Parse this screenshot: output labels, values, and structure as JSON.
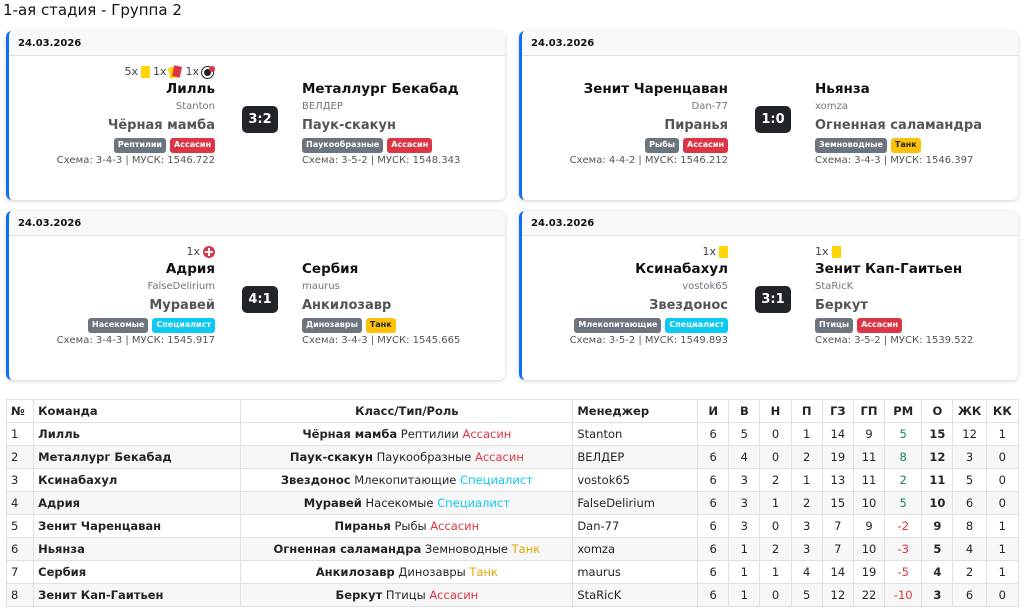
{
  "page": {
    "title": "1-ая стадия - Группа 2"
  },
  "colors": {
    "accent": "#0d6efd",
    "badge_gray": "#6c757d",
    "badge_red": "#dc3545",
    "badge_cyan": "#0dcaf0",
    "badge_yellow": "#ffc107"
  },
  "matches": [
    {
      "date": "24.03.2026",
      "score": "3:2",
      "home": {
        "events": [
          {
            "count": "5x",
            "icon": "yellow-card-icon"
          },
          {
            "count": "1x",
            "icon": "red-card-icon"
          },
          {
            "count": "1x",
            "icon": "own-goal-icon"
          }
        ],
        "team": "Лилль",
        "manager": "Stanton",
        "character": "Чёрная мамба",
        "badges": [
          {
            "text": "Рептилии",
            "color": "#6c757d"
          },
          {
            "text": "Ассасин",
            "color": "#dc3545"
          }
        ],
        "scheme": "Схема: 3-4-3 | МУСК: 1546.722"
      },
      "away": {
        "events": [],
        "team": "Металлург Бекабад",
        "manager": "ВЕЛДЕР",
        "character": "Паук-скакун",
        "badges": [
          {
            "text": "Паукообразные",
            "color": "#6c757d"
          },
          {
            "text": "Ассасин",
            "color": "#dc3545"
          }
        ],
        "scheme": "Схема: 3-5-2 | МУСК: 1548.343"
      }
    },
    {
      "date": "24.03.2026",
      "score": "1:0",
      "home": {
        "events": [],
        "team": "Зенит Чаренцаван",
        "manager": "Dan-77",
        "character": "Пиранья",
        "badges": [
          {
            "text": "Рыбы",
            "color": "#6c757d"
          },
          {
            "text": "Ассасин",
            "color": "#dc3545"
          }
        ],
        "scheme": "Схема: 4-4-2 | МУСК: 1546.212"
      },
      "away": {
        "events": [],
        "team": "Ньянза",
        "manager": "xomza",
        "character": "Огненная саламандра",
        "badges": [
          {
            "text": "Земноводные",
            "color": "#6c757d"
          },
          {
            "text": "Танк",
            "color": "#ffc107"
          }
        ],
        "scheme": "Схема: 3-4-3 | МУСК: 1546.397"
      }
    },
    {
      "date": "24.03.2026",
      "score": "4:1",
      "home": {
        "events": [
          {
            "count": "1x",
            "icon": "injury-icon"
          }
        ],
        "team": "Адрия",
        "manager": "FalseDelirium",
        "character": "Муравей",
        "badges": [
          {
            "text": "Насекомые",
            "color": "#6c757d"
          },
          {
            "text": "Специалист",
            "color": "#0dcaf0"
          }
        ],
        "scheme": "Схема: 3-4-3 | МУСК: 1545.917"
      },
      "away": {
        "events": [],
        "team": "Сербия",
        "manager": "maurus",
        "character": "Анкилозавр",
        "badges": [
          {
            "text": "Динозавры",
            "color": "#6c757d"
          },
          {
            "text": "Танк",
            "color": "#ffc107"
          }
        ],
        "scheme": "Схема: 3-4-3 | МУСК: 1545.665"
      }
    },
    {
      "date": "24.03.2026",
      "score": "3:1",
      "home": {
        "events": [
          {
            "count": "1x",
            "icon": "yellow-card-icon"
          }
        ],
        "team": "Ксинабахул",
        "manager": "vostok65",
        "character": "Звездонос",
        "badges": [
          {
            "text": "Млекопитающие",
            "color": "#6c757d"
          },
          {
            "text": "Специалист",
            "color": "#0dcaf0"
          }
        ],
        "scheme": "Схема: 3-5-2 | МУСК: 1549.893"
      },
      "away": {
        "events": [
          {
            "count": "1x",
            "icon": "yellow-card-icon"
          }
        ],
        "team": "Зенит Кап-Гаитьен",
        "manager": "StaRicK",
        "character": "Беркут",
        "badges": [
          {
            "text": "Птицы",
            "color": "#6c757d"
          },
          {
            "text": "Ассасин",
            "color": "#dc3545"
          }
        ],
        "scheme": "Схема: 3-5-2 | МУСК: 1539.522"
      }
    }
  ],
  "standings": {
    "headers": [
      "№",
      "Команда",
      "Класс/Тип/Роль",
      "Менеджер",
      "И",
      "В",
      "Н",
      "П",
      "ГЗ",
      "ГП",
      "РМ",
      "О",
      "ЖК",
      "КК"
    ],
    "rows": [
      {
        "n": "1",
        "team": "Лилль",
        "char": "Чёрная мамба",
        "type": "Рептилии",
        "role": "Ассасин",
        "role_color": "red",
        "manager": "Stanton",
        "stats": [
          "6",
          "5",
          "0",
          "1",
          "14",
          "9"
        ],
        "rm": "5",
        "pts": "15",
        "yc": "12",
        "rc": "1"
      },
      {
        "n": "2",
        "team": "Металлург Бекабад",
        "char": "Паук-скакун",
        "type": "Паукообразные",
        "role": "Ассасин",
        "role_color": "red",
        "manager": "ВЕЛДЕР",
        "stats": [
          "6",
          "4",
          "0",
          "2",
          "19",
          "11"
        ],
        "rm": "8",
        "pts": "12",
        "yc": "3",
        "rc": "0"
      },
      {
        "n": "3",
        "team": "Ксинабахул",
        "char": "Звездонос",
        "type": "Млекопитающие",
        "role": "Специалист",
        "role_color": "cyan",
        "manager": "vostok65",
        "stats": [
          "6",
          "3",
          "2",
          "1",
          "13",
          "11"
        ],
        "rm": "2",
        "pts": "11",
        "yc": "5",
        "rc": "0"
      },
      {
        "n": "4",
        "team": "Адрия",
        "char": "Муравей",
        "type": "Насекомые",
        "role": "Специалист",
        "role_color": "cyan",
        "manager": "FalseDelirium",
        "stats": [
          "6",
          "3",
          "1",
          "2",
          "15",
          "10"
        ],
        "rm": "5",
        "pts": "10",
        "yc": "6",
        "rc": "0"
      },
      {
        "n": "5",
        "team": "Зенит Чаренцаван",
        "char": "Пиранья",
        "type": "Рыбы",
        "role": "Ассасин",
        "role_color": "red",
        "manager": "Dan-77",
        "stats": [
          "6",
          "3",
          "0",
          "3",
          "7",
          "9"
        ],
        "rm": "-2",
        "pts": "9",
        "yc": "8",
        "rc": "1"
      },
      {
        "n": "6",
        "team": "Ньянза",
        "char": "Огненная саламандра",
        "type": "Земноводные",
        "role": "Танк",
        "role_color": "yellow",
        "manager": "xomza",
        "stats": [
          "6",
          "1",
          "2",
          "3",
          "7",
          "10"
        ],
        "rm": "-3",
        "pts": "5",
        "yc": "4",
        "rc": "1"
      },
      {
        "n": "7",
        "team": "Сербия",
        "char": "Анкилозавр",
        "type": "Динозавры",
        "role": "Танк",
        "role_color": "yellow",
        "manager": "maurus",
        "stats": [
          "6",
          "1",
          "1",
          "4",
          "14",
          "19"
        ],
        "rm": "-5",
        "pts": "4",
        "yc": "2",
        "rc": "1"
      },
      {
        "n": "8",
        "team": "Зенит Кап-Гаитьен",
        "char": "Беркут",
        "type": "Птицы",
        "role": "Ассасин",
        "role_color": "red",
        "manager": "StaRicK",
        "stats": [
          "6",
          "1",
          "0",
          "5",
          "12",
          "22"
        ],
        "rm": "-10",
        "pts": "3",
        "yc": "6",
        "rc": "0"
      }
    ]
  }
}
